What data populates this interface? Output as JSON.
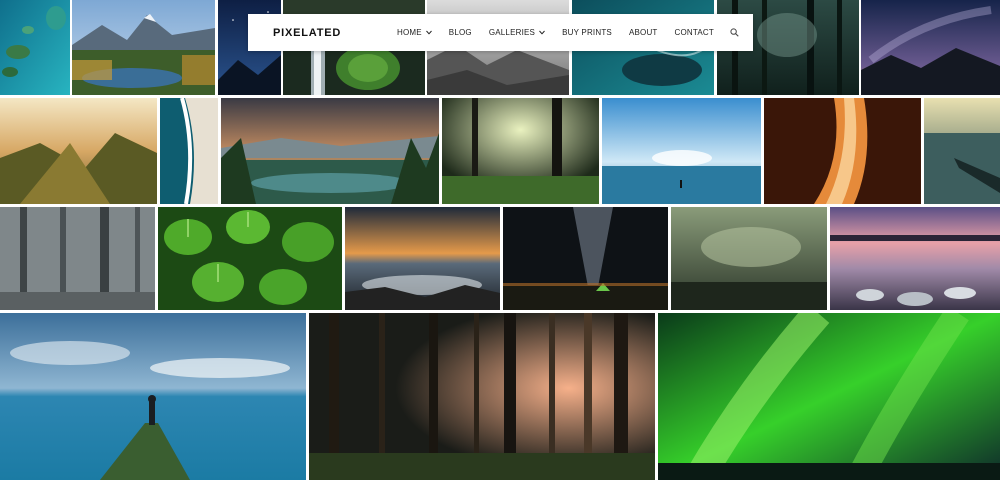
{
  "site": {
    "logo": "PIXELATED"
  },
  "nav": {
    "items": [
      {
        "label": "HOME",
        "has_dropdown": true
      },
      {
        "label": "BLOG",
        "has_dropdown": false
      },
      {
        "label": "GALLERIES",
        "has_dropdown": true
      },
      {
        "label": "BUY PRINTS",
        "has_dropdown": false
      },
      {
        "label": "ABOUT",
        "has_dropdown": false
      },
      {
        "label": "CONTACT",
        "has_dropdown": false
      }
    ],
    "search_icon": "search-icon"
  },
  "gallery": {
    "rows": 4,
    "tiles": [
      "turquoise-islands-aerial",
      "mountain-lake-forest",
      "night-sky-mountain",
      "waterfall-forest",
      "misty-valley-bw",
      "aerial-ocean-rocks",
      "dark-forest-mist",
      "milky-way-mountains",
      "mountain-ridge-sunset",
      "aerial-beach-waves",
      "mountain-lake-trees",
      "sunlit-forest",
      "ocean-horizon-sun",
      "antelope-canyon",
      "lake-rowboat",
      "foggy-forest",
      "green-leaves",
      "ocean-rocks-sunset",
      "milky-way-tent",
      "misty-green-forest",
      "lakeshore-twilight",
      "person-on-seawall",
      "forest-tree-trunks",
      "green-aurora"
    ]
  }
}
